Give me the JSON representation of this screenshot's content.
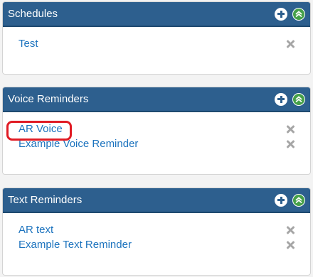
{
  "colors": {
    "header_bg": "#2d5f8e",
    "link": "#1c73be",
    "collapse_green": "#46a049",
    "highlight_red": "#e01b24",
    "delete_gray": "#a6a6a6"
  },
  "panels": [
    {
      "title": "Schedules",
      "items": [
        {
          "label": "Test"
        }
      ]
    },
    {
      "title": "Voice Reminders",
      "items": [
        {
          "label": "AR Voice"
        },
        {
          "label": "Example Voice Reminder"
        }
      ],
      "highlighted_item": "AR Voice"
    },
    {
      "title": "Text Reminders",
      "items": [
        {
          "label": "AR text"
        },
        {
          "label": "Example Text Reminder"
        }
      ]
    }
  ],
  "icons": {
    "add": "plus-circle-icon",
    "collapse": "chevron-double-up-icon",
    "delete": "x-icon"
  }
}
